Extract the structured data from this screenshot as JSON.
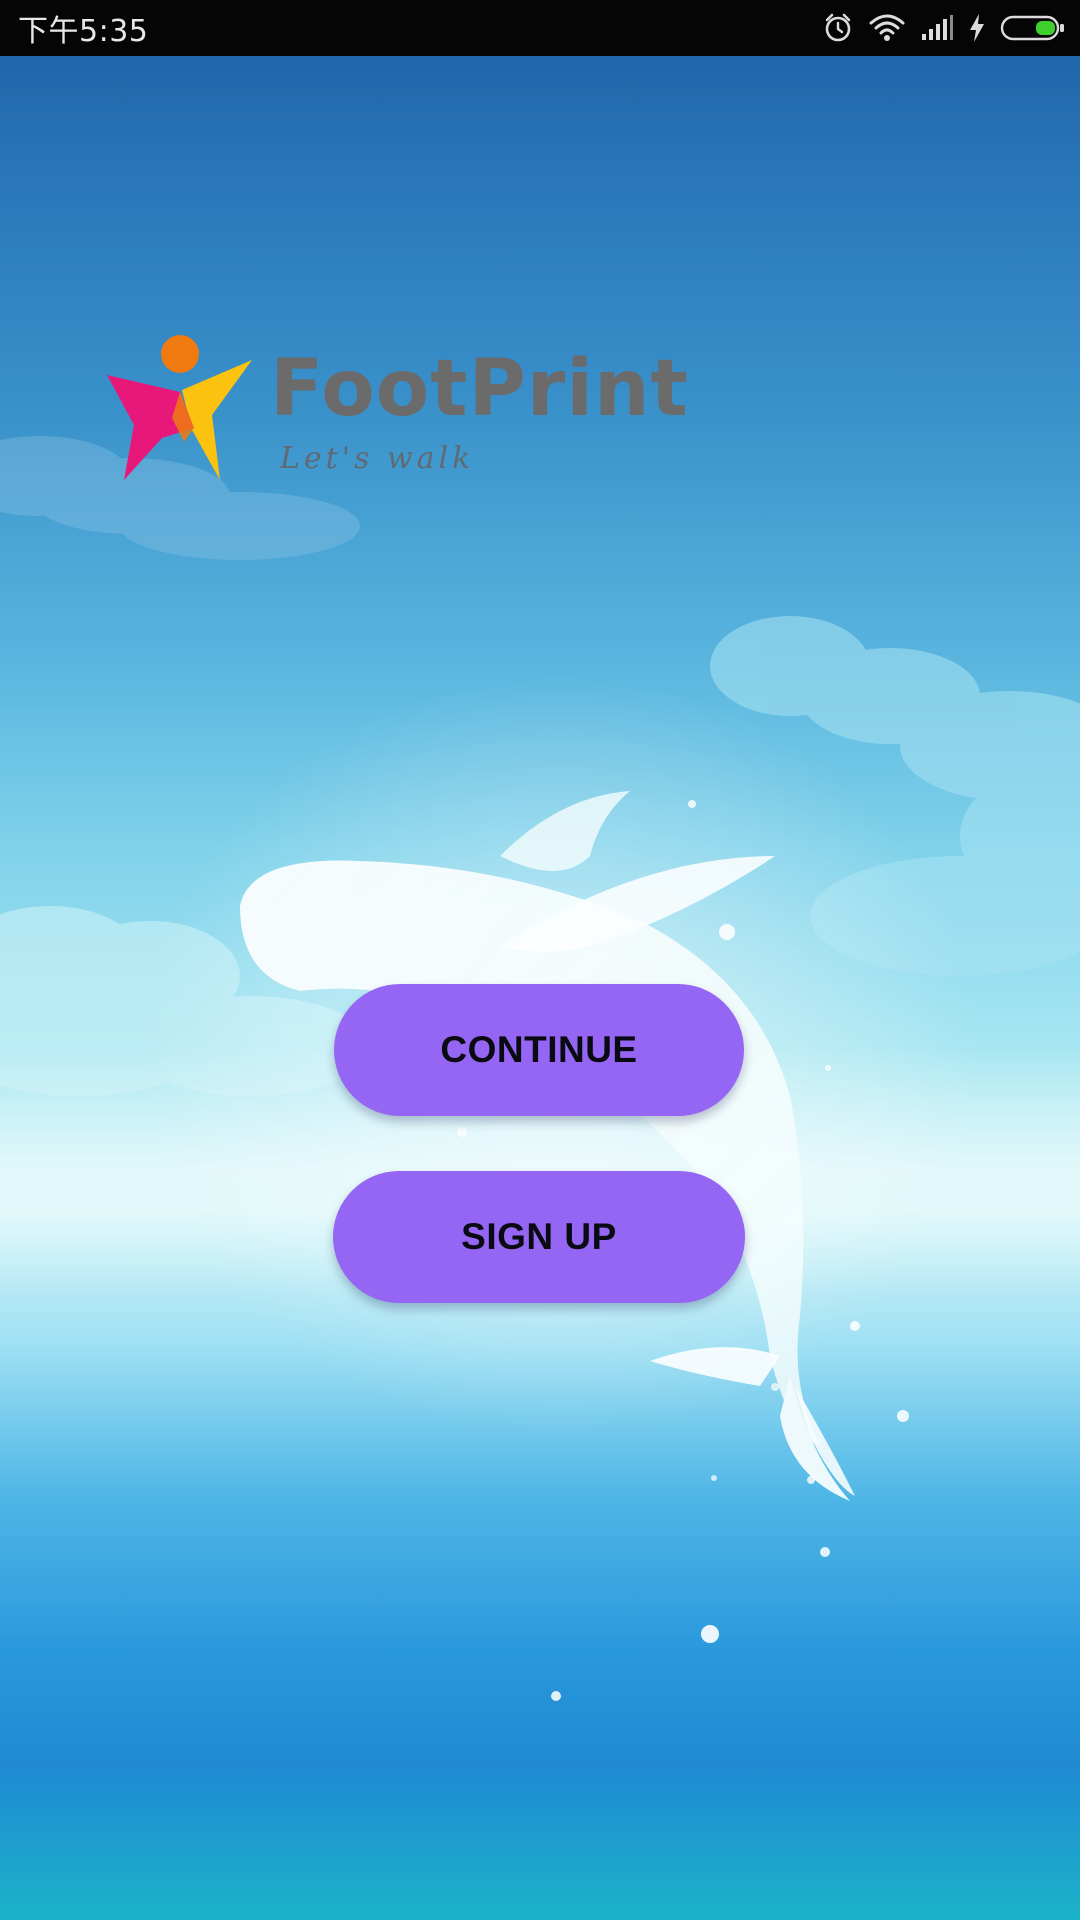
{
  "status_bar": {
    "time": "下午5:35",
    "icons": [
      "alarm-icon",
      "wifi-icon",
      "cellular-signal-icon",
      "charging-icon",
      "battery-icon"
    ],
    "battery_color": "#3ecf2e"
  },
  "brand": {
    "name": "FootPrint",
    "tagline": "Let's walk",
    "logo_colors": {
      "head": "#f07a10",
      "left_wing": "#e8187a",
      "right_wing": "#fbc20f",
      "text": "#6b6b6b"
    }
  },
  "actions": {
    "continue_label": "CONTINUE",
    "signup_label": "SIGN UP",
    "button_color": "#9565f3"
  },
  "background": {
    "scene": "whale-sky",
    "colors": [
      "#1a5fa3",
      "#7ed1ea",
      "#d5f6f8",
      "#2a98dc",
      "#1cb3c9"
    ]
  }
}
